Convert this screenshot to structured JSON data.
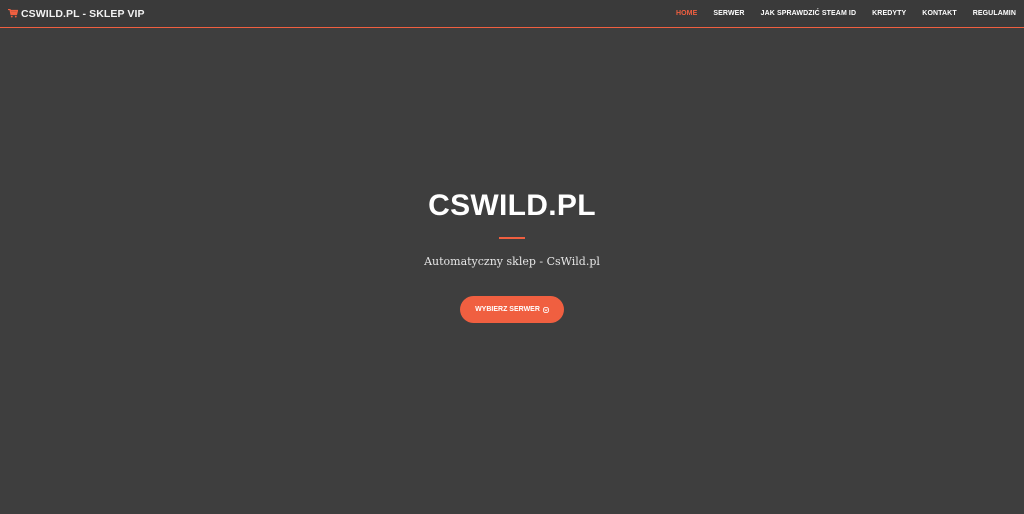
{
  "navbar": {
    "brand": {
      "icon": "shopping-cart-icon",
      "label": "CSWILD.PL - SKLEP VIP"
    },
    "links": [
      {
        "label": "HOME",
        "active": true
      },
      {
        "label": "SERWER",
        "active": false
      },
      {
        "label": "JAK SPRAWDZIĆ STEAM ID",
        "active": false
      },
      {
        "label": "KREDYTY",
        "active": false
      },
      {
        "label": "KONTAKT",
        "active": false
      },
      {
        "label": "REGULAMIN",
        "active": false
      }
    ]
  },
  "hero": {
    "title": "CSWILD.PL",
    "subtitle": "Automatyczny sklep - CsWild.pl",
    "button": {
      "label": "WYBIERZ SERWER",
      "icon": "chevron-down-circle-icon"
    }
  },
  "colors": {
    "background": "#3e3e3e",
    "accent": "#f05f40",
    "text": "#ffffff"
  }
}
